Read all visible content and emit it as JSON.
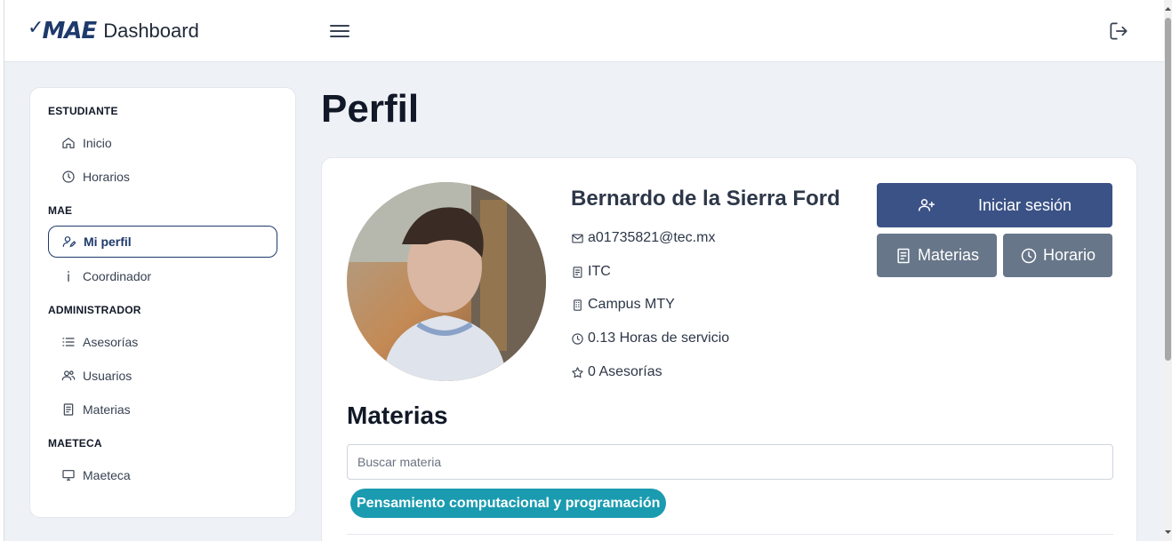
{
  "app": {
    "logo_mark": "MAE",
    "title": "Dashboard"
  },
  "sidebar": {
    "sections": [
      {
        "title": "ESTUDIANTE",
        "items": [
          {
            "label": "Inicio",
            "icon": "home-icon"
          },
          {
            "label": "Horarios",
            "icon": "clock-icon"
          }
        ]
      },
      {
        "title": "MAE",
        "items": [
          {
            "label": "Mi perfil",
            "icon": "user-edit-icon",
            "active": true
          },
          {
            "label": "Coordinador",
            "icon": "info-icon"
          }
        ]
      },
      {
        "title": "ADMINISTRADOR",
        "items": [
          {
            "label": "Asesorías",
            "icon": "list-icon"
          },
          {
            "label": "Usuarios",
            "icon": "users-icon"
          },
          {
            "label": "Materias",
            "icon": "book-icon"
          }
        ]
      },
      {
        "title": "MAETECA",
        "items": [
          {
            "label": "Maeteca",
            "icon": "monitor-icon"
          }
        ]
      }
    ]
  },
  "page": {
    "title": "Perfil"
  },
  "profile": {
    "name": "Bernardo de la Sierra Ford",
    "email": "a01735821@tec.mx",
    "career": "ITC",
    "campus": "Campus MTY",
    "service_hours": "0.13 Horas de servicio",
    "sessions": "0 Asesorías"
  },
  "actions": {
    "login": "Iniciar sesión",
    "subjects": "Materias",
    "schedule": "Horario"
  },
  "materias": {
    "title": "Materias",
    "search_placeholder": "Buscar materia",
    "tags": [
      "Pensamiento computacional y programación"
    ]
  },
  "colors": {
    "brand": "#1e3a6b",
    "primary_button": "#3b5286",
    "secondary_button": "#677689",
    "tag": "#1a9bb0"
  }
}
